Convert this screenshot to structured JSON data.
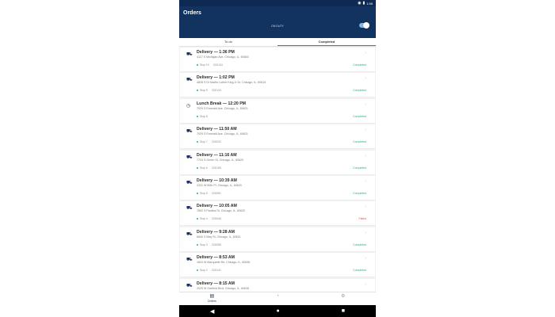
{
  "status_bar": {
    "time": "1:58"
  },
  "app_bar": {
    "title": "Orders",
    "duty_label": "ON DUTY",
    "toggle_on": true
  },
  "tabs": [
    {
      "label": "To do",
      "active": false
    },
    {
      "label": "Completed",
      "active": true
    }
  ],
  "orders": [
    {
      "icon": "truck-icon",
      "title": "Delivery — 1:36 PM",
      "address": "4117 S Michigan Ave, Chicago, IL, 60653",
      "stop": "Stop 10",
      "id": "C00134",
      "status": "Completed"
    },
    {
      "icon": "truck-icon",
      "title": "Delivery — 1:02 PM",
      "address": "4828 S Dr Martin Luther King Jr Dr, Chicago, IL, 60615",
      "stop": "Stop 9",
      "id": "C00133",
      "status": "Completed"
    },
    {
      "icon": "clock-icon",
      "title": "Lunch Break — 12:20 PM",
      "address": "7029 S Emerald Ave, Chicago, IL, 60621",
      "stop": "Stop 8",
      "id": "",
      "status": "Completed"
    },
    {
      "icon": "truck-icon",
      "title": "Delivery — 11:50 AM",
      "address": "7029 S Emerald Ave, Chicago, IL, 60621",
      "stop": "Stop 7",
      "id": "C00032",
      "status": "Completed"
    },
    {
      "icon": "truck-icon",
      "title": "Delivery — 11:16 AM",
      "address": "7724 S Green St, Chicago, IL, 60620",
      "stop": "Stop 6",
      "id": "C00155",
      "status": "Completed"
    },
    {
      "icon": "truck-icon",
      "title": "Delivery — 10:39 AM",
      "address": "2331 W 80th Pl, Chicago, IL, 60620",
      "stop": "Stop 5",
      "id": "C00051",
      "status": "Completed"
    },
    {
      "icon": "truck-icon",
      "title": "Delivery — 10:05 AM",
      "address": "7802 S Paulina St, Chicago, IL, 60620",
      "stop": "Stop 4",
      "id": "C00048",
      "status": "Failed"
    },
    {
      "icon": "truck-icon",
      "title": "Delivery — 9:28 AM",
      "address": "6840 S May St, Chicago, IL, 60621",
      "stop": "Stop 3",
      "id": "C00085",
      "status": "Completed"
    },
    {
      "icon": "truck-icon",
      "title": "Delivery — 8:53 AM",
      "address": "1824 W Marquette Rd, Chicago, IL, 60636",
      "stop": "Stop 2",
      "id": "C00141",
      "status": "Completed"
    },
    {
      "icon": "truck-icon",
      "title": "Delivery — 8:15 AM",
      "address": "2025 W Garfield Blvd, Chicago, IL, 60636",
      "stop": "Stop 1",
      "id": "C00017",
      "status": "Completed"
    }
  ],
  "bottom_nav": [
    {
      "icon": "orders-icon",
      "label": "Orders",
      "active": true
    },
    {
      "icon": "stats-icon",
      "label": "",
      "active": false
    },
    {
      "icon": "settings-icon",
      "label": "",
      "active": false
    }
  ],
  "colors": {
    "app_bar": "#12325f",
    "accent": "#1e88c7",
    "completed": "#2fae84",
    "failed": "#d9534f"
  }
}
